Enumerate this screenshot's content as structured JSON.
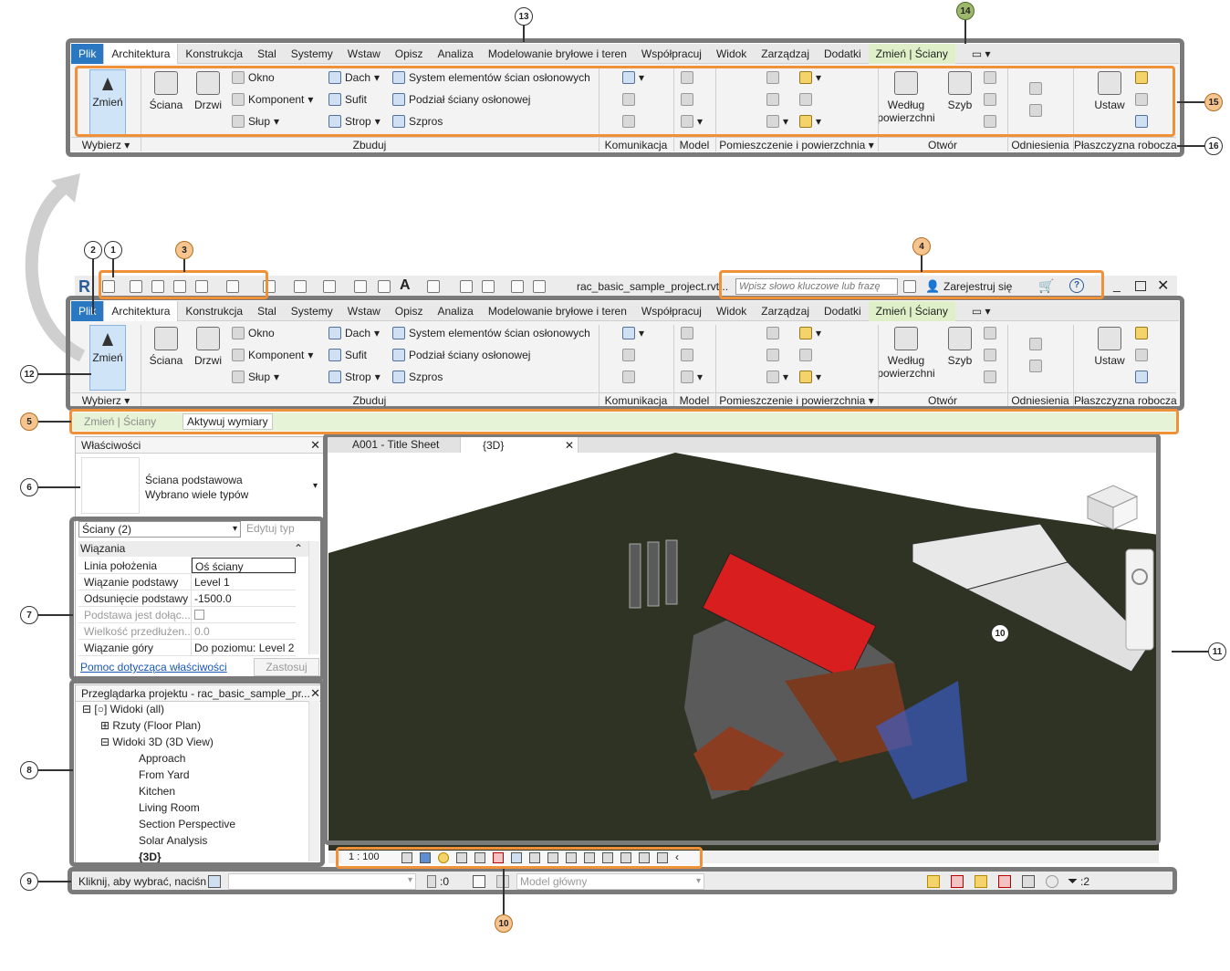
{
  "callouts": {
    "c1": "1",
    "c2": "2",
    "c3": "3",
    "c4": "4",
    "c5": "5",
    "c6": "6",
    "c7": "7",
    "c8": "8",
    "c9": "9",
    "c10": "10",
    "c10b": "10",
    "c11": "11",
    "c12": "12",
    "c13": "13",
    "c14": "14",
    "c15": "15",
    "c16": "16"
  },
  "ribbon": {
    "tabs": [
      "Plik",
      "Architektura",
      "Konstrukcja",
      "Stal",
      "Systemy",
      "Wstaw",
      "Opisz",
      "Analiza",
      "Modelowanie bryłowe i teren",
      "Współpracuj",
      "Widok",
      "Zarządzaj",
      "Dodatki",
      "Zmień | Ściany"
    ],
    "select": {
      "modify": "Zmień"
    },
    "build": {
      "wall": "Ściana",
      "door": "Drzwi",
      "window": "Okno",
      "component": "Komponent",
      "column": "Słup",
      "roof": "Dach",
      "ceiling": "Sufit",
      "floor": "Strop",
      "curtain_system": "System elementów ścian osłonowych",
      "curtain_grid": "Podział ściany osłonowej",
      "mullion": "Szpros"
    },
    "opening": {
      "by_face": "Według powierzchni",
      "shaft": "Szyb"
    },
    "workplane": {
      "set": "Ustaw"
    },
    "panels": {
      "select": "Wybierz",
      "build": "Zbuduj",
      "circulation": "Komunikacja",
      "model": "Model",
      "room": "Pomieszczenie i powierzchnia",
      "opening": "Otwór",
      "datum": "Odniesienia",
      "workplane": "Płaszczyzna robocza"
    }
  },
  "qat": {
    "filename": "rac_basic_sample_project.rvt...",
    "search_placeholder": "Wpisz słowo kluczowe lub frazę",
    "sign_in": "Zarejestruj się"
  },
  "options_bar": {
    "context": "Zmień | Ściany",
    "activate_dims": "Aktywuj wymiary"
  },
  "properties": {
    "title": "Właściwości",
    "type_name": "Ściana podstawowa",
    "type_sub": "Wybrano wiele typów",
    "selector": "Ściany (2)",
    "edit_type": "Edytuj typ",
    "group": "Wiązania",
    "rows": [
      {
        "k": "Linia położenia",
        "v": "Oś ściany"
      },
      {
        "k": "Wiązanie podstawy",
        "v": "Level 1"
      },
      {
        "k": "Odsunięcie podstawy",
        "v": "-1500.0"
      },
      {
        "k": "Podstawa jest dołąc...",
        "v": ""
      },
      {
        "k": "Wielkość przedłużen...",
        "v": "0.0"
      },
      {
        "k": "Wiązanie góry",
        "v": "Do poziomu: Level 2"
      }
    ],
    "help_link": "Pomoc dotycząca właściwości",
    "apply": "Zastosuj"
  },
  "browser": {
    "title": "Przeglądarka projektu - rac_basic_sample_pr...",
    "root": "Widoki (all)",
    "floor_plans": "Rzuty (Floor Plan)",
    "views3d": "Widoki 3D (3D View)",
    "items": [
      "Approach",
      "From Yard",
      "Kitchen",
      "Living Room",
      "Section Perspective",
      "Solar Analysis",
      "{3D}"
    ]
  },
  "view_tabs": {
    "sheet": "A001 - Title Sheet",
    "v3d": "{3D}"
  },
  "view_control": {
    "scale": "1 : 100"
  },
  "status": {
    "message": "Kliknij, aby wybrać, naciśn",
    "zero": ":0",
    "model": "Model główny",
    "filter": ":2"
  },
  "colors": {
    "file_tab": "#2b78c2",
    "context_tab": "#dff0c8",
    "highlight": "#f0913a",
    "roof": "#d81e1e",
    "terrain": "#2e3323"
  }
}
